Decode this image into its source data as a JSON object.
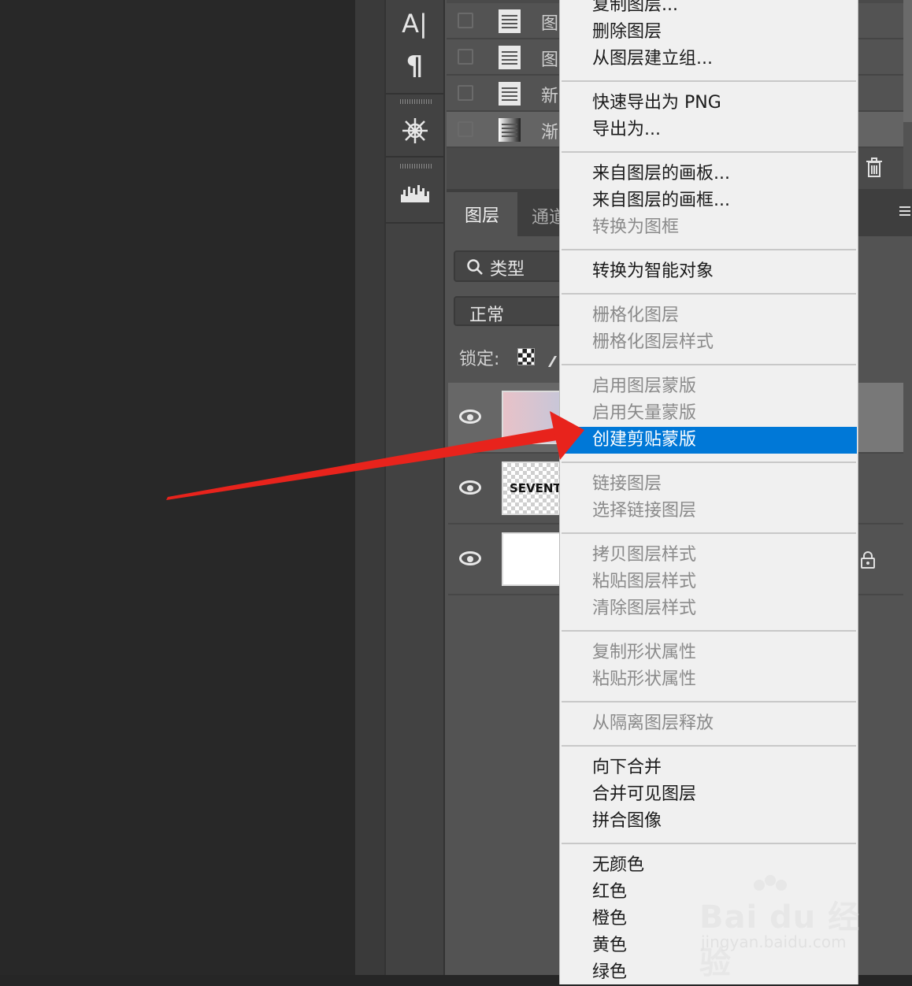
{
  "top_panel": {
    "rows": [
      {
        "name": "图",
        "icon": "document-icon"
      },
      {
        "name": "图",
        "icon": "document-icon"
      },
      {
        "name": "新",
        "icon": "document-icon"
      },
      {
        "name": "渐",
        "icon": "gradient-icon"
      }
    ]
  },
  "tools": {
    "type_tool": "A|",
    "paragraph_tool": "¶"
  },
  "layers_panel": {
    "tab_layers": "图层",
    "tab_channels": "通道",
    "filter_label": "类型",
    "blend_mode": "正常",
    "lock_label": "锁定:",
    "layers": [
      {
        "thumb": "gradient",
        "text": ""
      },
      {
        "thumb": "text",
        "text": "SEVENT"
      },
      {
        "thumb": "background",
        "text": ""
      }
    ]
  },
  "context_menu": {
    "items": [
      {
        "label": "复制图层...",
        "enabled": true
      },
      {
        "label": "删除图层",
        "enabled": true
      },
      {
        "label": "从图层建立组...",
        "enabled": true
      },
      {
        "sep": true
      },
      {
        "label": "快速导出为 PNG",
        "enabled": true
      },
      {
        "label": "导出为...",
        "enabled": true
      },
      {
        "sep": true
      },
      {
        "label": "来自图层的画板...",
        "enabled": true
      },
      {
        "label": "来自图层的画框...",
        "enabled": true
      },
      {
        "label": "转换为图框",
        "enabled": false
      },
      {
        "sep": true
      },
      {
        "label": "转换为智能对象",
        "enabled": true
      },
      {
        "sep": true
      },
      {
        "label": "栅格化图层",
        "enabled": false
      },
      {
        "label": "栅格化图层样式",
        "enabled": false
      },
      {
        "sep": true
      },
      {
        "label": "启用图层蒙版",
        "enabled": false
      },
      {
        "label": "启用矢量蒙版",
        "enabled": false
      },
      {
        "label": "创建剪贴蒙版",
        "enabled": true,
        "highlighted": true
      },
      {
        "sep": true
      },
      {
        "label": "链接图层",
        "enabled": false
      },
      {
        "label": "选择链接图层",
        "enabled": false
      },
      {
        "sep": true
      },
      {
        "label": "拷贝图层样式",
        "enabled": false
      },
      {
        "label": "粘贴图层样式",
        "enabled": false
      },
      {
        "label": "清除图层样式",
        "enabled": false
      },
      {
        "sep": true
      },
      {
        "label": "复制形状属性",
        "enabled": false
      },
      {
        "label": "粘贴形状属性",
        "enabled": false
      },
      {
        "sep": true
      },
      {
        "label": "从隔离图层释放",
        "enabled": false
      },
      {
        "sep": true
      },
      {
        "label": "向下合并",
        "enabled": true
      },
      {
        "label": "合并可见图层",
        "enabled": true
      },
      {
        "label": "拼合图像",
        "enabled": true
      },
      {
        "sep": true
      },
      {
        "label": "无颜色",
        "enabled": true
      },
      {
        "label": "红色",
        "enabled": true
      },
      {
        "label": "橙色",
        "enabled": true
      },
      {
        "label": "黄色",
        "enabled": true
      },
      {
        "label": "绿色",
        "enabled": true
      }
    ]
  },
  "watermark": {
    "brand": "Bai du 经验",
    "url": "jingyan.baidu.com"
  },
  "colors": {
    "menu_highlight": "#0078d7",
    "arrow": "#e8231c"
  }
}
